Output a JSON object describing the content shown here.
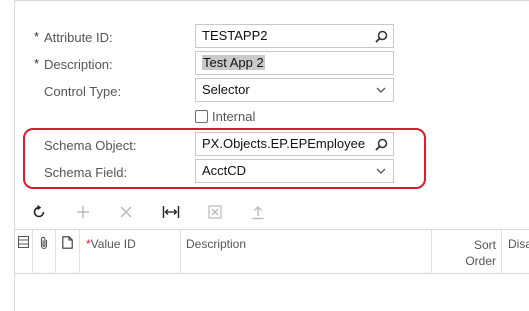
{
  "form": {
    "attribute_id": {
      "label": "Attribute ID:",
      "required_mark": "*",
      "value": "TESTAPP2"
    },
    "description": {
      "label": "Description:",
      "required_mark": "*",
      "value": "Test App 2"
    },
    "control_type": {
      "label": "Control Type:",
      "value": "Selector"
    },
    "internal": {
      "label": "Internal",
      "checked": false
    },
    "schema_object": {
      "label": "Schema Object:",
      "value": "PX.Objects.EP.EPEmployee"
    },
    "schema_field": {
      "label": "Schema Field:",
      "value": "AcctCD"
    }
  },
  "toolbar": {
    "buttons": [
      "refresh-icon",
      "add-icon",
      "delete-icon",
      "fit-columns-icon",
      "export-excel-icon",
      "upload-icon"
    ]
  },
  "grid": {
    "columns": {
      "value_id": {
        "required_mark": "*",
        "label": "Value ID"
      },
      "description": "Description",
      "sort_order_line1": "Sort",
      "sort_order_line2": "Order",
      "disabled_partial": "Disa"
    },
    "rows": []
  },
  "colors": {
    "highlight": "#d41f2e",
    "border": "#c8c8c8"
  }
}
